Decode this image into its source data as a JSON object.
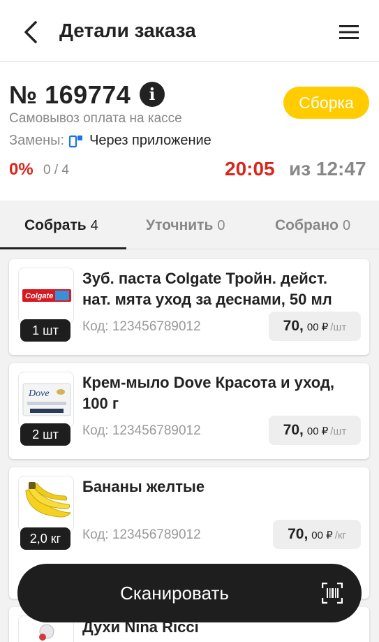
{
  "header": {
    "title": "Детали заказа",
    "back_icon": "chevron-left-icon",
    "menu_icon": "hamburger-menu-icon"
  },
  "order": {
    "number": "№ 169774",
    "status": "Сборка",
    "delivery": "Самовывоз оплата на кассе",
    "replacements_label": "Замены:",
    "replacements_value": "Через приложение",
    "progress_percent": "0%",
    "progress_count": "0 / 4",
    "time_current": "20:05",
    "time_total": "из 12:47"
  },
  "tabs": [
    {
      "label": "Собрать",
      "count": "4"
    },
    {
      "label": "Уточнить",
      "count": "0"
    },
    {
      "label": "Собрано",
      "count": "0"
    }
  ],
  "items": [
    {
      "name": "Зуб. паста Colgate Тройн. дейст. нат. мята уход за деснами, 50 мл",
      "qty": "1 шт",
      "code": "Код: 123456789012",
      "price_int": "70,",
      "price_dec": "00 ₽",
      "unit": "/шт"
    },
    {
      "name": "Крем-мыло Dove Красота и уход, 100 г",
      "qty": "2 шт",
      "code": "Код: 123456789012",
      "price_int": "70,",
      "price_dec": "00 ₽",
      "unit": "/шт"
    },
    {
      "name": "Бананы желтые",
      "qty": "2,0 кг",
      "code": "Код: 123456789012",
      "price_int": "70,",
      "price_dec": "00 ₽",
      "unit": "/кг"
    },
    {
      "name": "Духи Nina Ricci"
    }
  ],
  "images": {
    "colgate_text": "Colgate",
    "dove_text": "Dove"
  },
  "scan_button": {
    "label": "Сканировать",
    "icon": "barcode-scan-icon"
  },
  "colors": {
    "accent_yellow": "#ffcc00",
    "alert_red": "#d9261c",
    "dark": "#1e1e1e"
  }
}
